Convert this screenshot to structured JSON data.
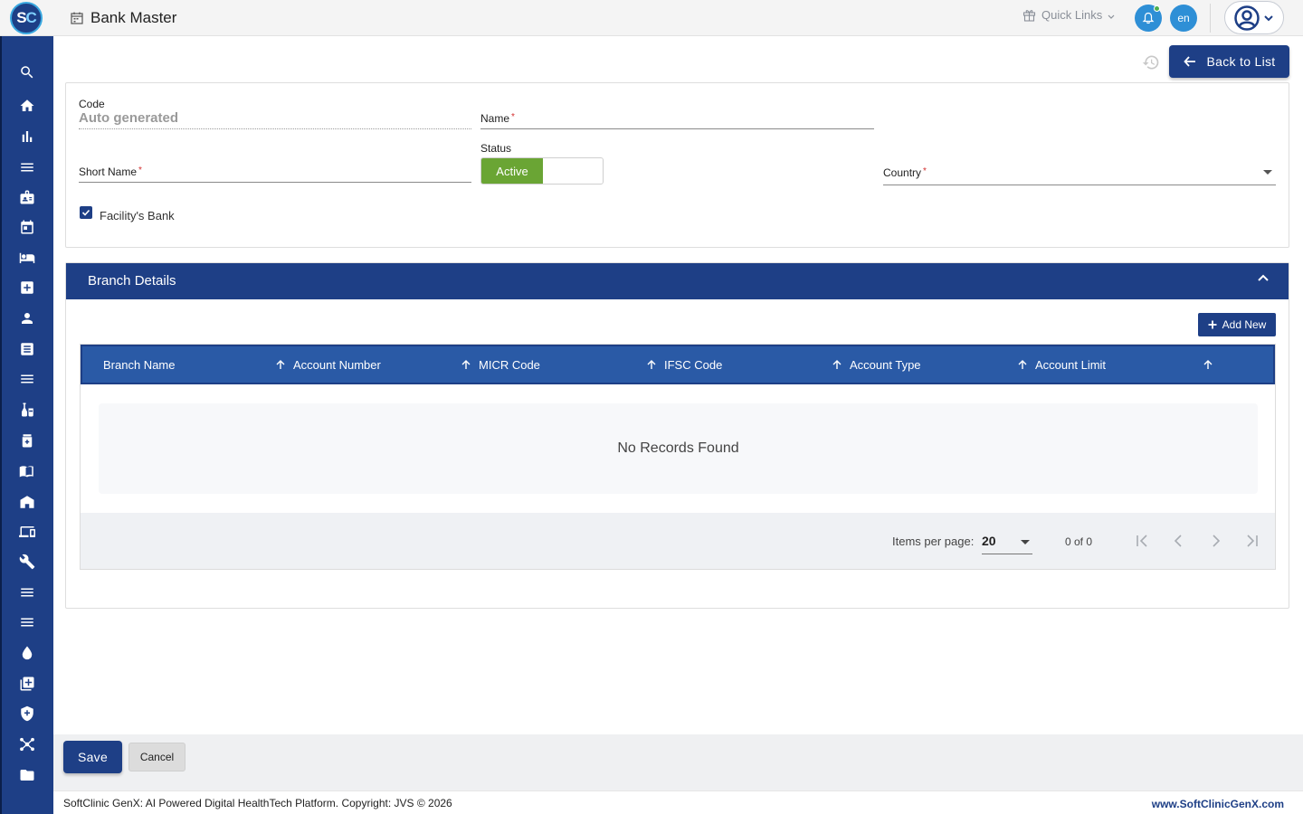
{
  "app": {
    "logo_text_s": "S",
    "logo_text_c": "C",
    "page_title": "Bank Master",
    "quick_links": "Quick Links",
    "language": "en"
  },
  "sidebar": {
    "icons": [
      "search-icon",
      "home-icon",
      "bar-chart-icon",
      "menu-icon",
      "badge-icon",
      "calendar-icon",
      "bed-icon",
      "medical-plus-icon",
      "person-icon",
      "document-icon",
      "list-icon",
      "tests-icon",
      "medicine-icon",
      "book-icon",
      "building-icon",
      "devices-icon",
      "wrench-icon",
      "lines-icon",
      "lines-icon",
      "drop-icon",
      "add-box-icon",
      "shield-icon",
      "network-icon",
      "folder-icon"
    ]
  },
  "toolbar": {
    "back_label": "Back to List"
  },
  "form": {
    "code_label": "Code",
    "code_value": "Auto generated",
    "name_label": "Name",
    "short_name_label": "Short Name",
    "status_label": "Status",
    "status_value": "Active",
    "country_label": "Country",
    "required_mark": "*",
    "facility_bank_label": "Facility's Bank",
    "facility_bank_checked": true
  },
  "branch": {
    "title": "Branch Details",
    "add_new_label": "Add New",
    "columns": [
      "Branch Name",
      "Account Number",
      "MICR Code",
      "IFSC Code",
      "Account Type",
      "Account Limit"
    ],
    "empty_message": "No Records Found",
    "items_per_page_label": "Items per page:",
    "items_per_page_value": "20",
    "range_label": "0 of 0"
  },
  "actions": {
    "save_label": "Save",
    "cancel_label": "Cancel"
  },
  "footer": {
    "copyright": "SoftClinic GenX: AI Powered Digital HealthTech Platform. Copyright: JVS © 2026",
    "website": "www.SoftClinicGenX.com"
  },
  "colors": {
    "primary": "#1e3f86",
    "table_header": "#2a5aa6",
    "active_green": "#6aa534",
    "notification": "#2e8fd6"
  }
}
